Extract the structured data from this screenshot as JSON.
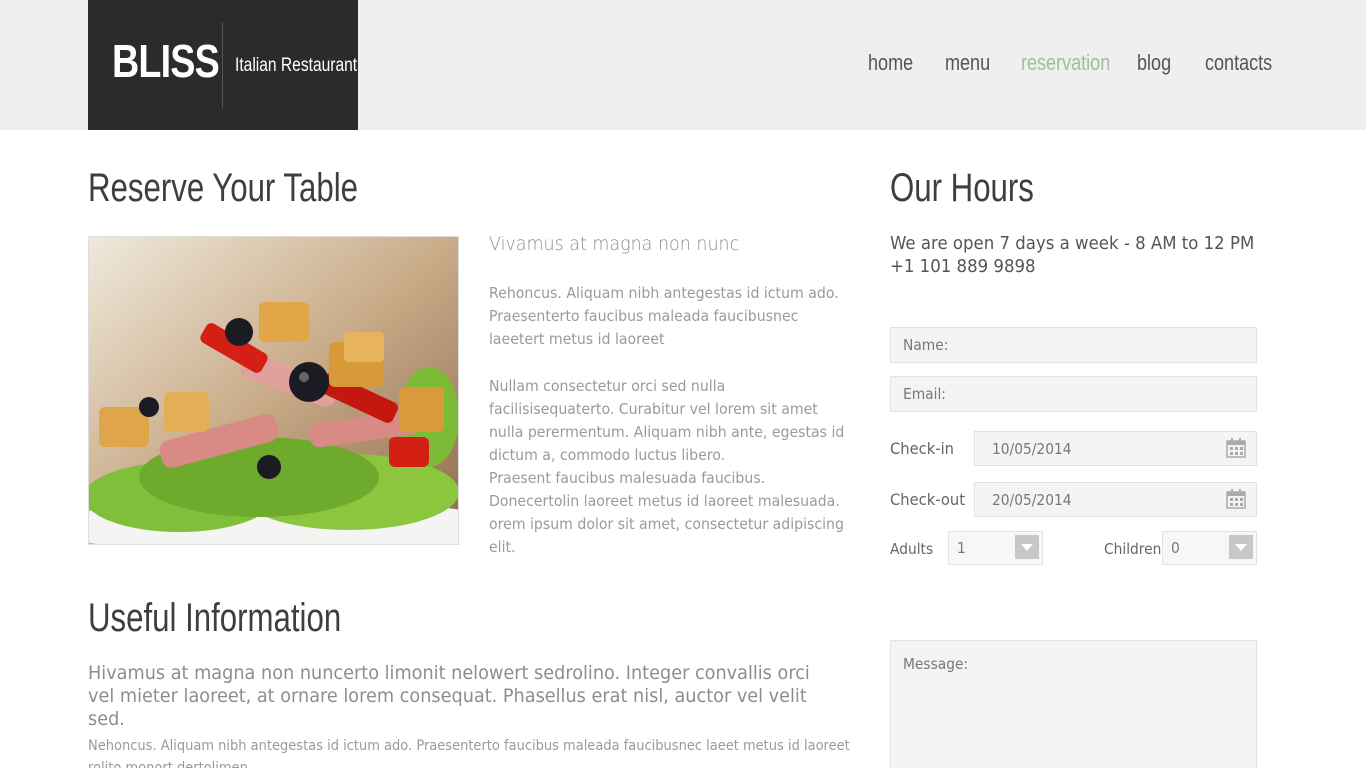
{
  "brand": {
    "name": "BLISS",
    "tagline": "Italian Restaurant"
  },
  "nav": [
    {
      "label": "home"
    },
    {
      "label": "menu"
    },
    {
      "label": "reservation",
      "active": true
    },
    {
      "label": "blog"
    },
    {
      "label": "contacts"
    }
  ],
  "reserve": {
    "title": "Reserve Your Table",
    "subtitle": "Vivamus at magna non nunc",
    "paragraphs": [
      "Rehoncus. Aliquam nibh antegestas id ictum ado. Praesenterto faucibus maleada faucibusnec laeetert metus id laoreet",
      "Nullam consectetur orci sed nulla facilisisequaterto. Curabitur vel lorem sit amet nulla perermentum. Aliquam nibh ante, egestas id dictum a, commodo luctus libero.",
      "Praesent faucibus malesuada faucibus. Donecertolin laoreet metus id laoreet malesuada. orem ipsum dolor sit amet, consectetur adipiscing elit."
    ]
  },
  "useful": {
    "title": "Useful Information",
    "lead": "Hivamus at magna non nuncerto limonit nelowert sedrolino. Integer convallis orci vel mieter laoreet, at ornare lorem consequat. Phasellus erat nisl, auctor vel velit sed.",
    "body": "Nehoncus. Aliquam nibh antegestas id ictum ado. Praesenterto faucibus maleada faucibusnec laeet metus id laoreet rolito monort dertolimen"
  },
  "hours": {
    "title": "Our Hours",
    "line1": "We are open 7 days a week - 8 AM to 12 PM",
    "phone": "+1 101 889 9898"
  },
  "form": {
    "name_placeholder": "Name:",
    "email_placeholder": "Email:",
    "checkin_label": "Check-in",
    "checkin_value": "10/05/2014",
    "checkout_label": "Check-out",
    "checkout_value": "20/05/2014",
    "adults_label": "Adults",
    "adults_value": "1",
    "children_label": "Children",
    "children_value": "0",
    "message_placeholder": "Message:"
  },
  "colors": {
    "accent": "#9bc19a",
    "header_bg": "#efefef",
    "logo_bg": "#2b2b2b",
    "heading": "#3e3e3e"
  },
  "icons": {
    "calendar": "calendar-icon",
    "select": "chevron-down-icon"
  }
}
